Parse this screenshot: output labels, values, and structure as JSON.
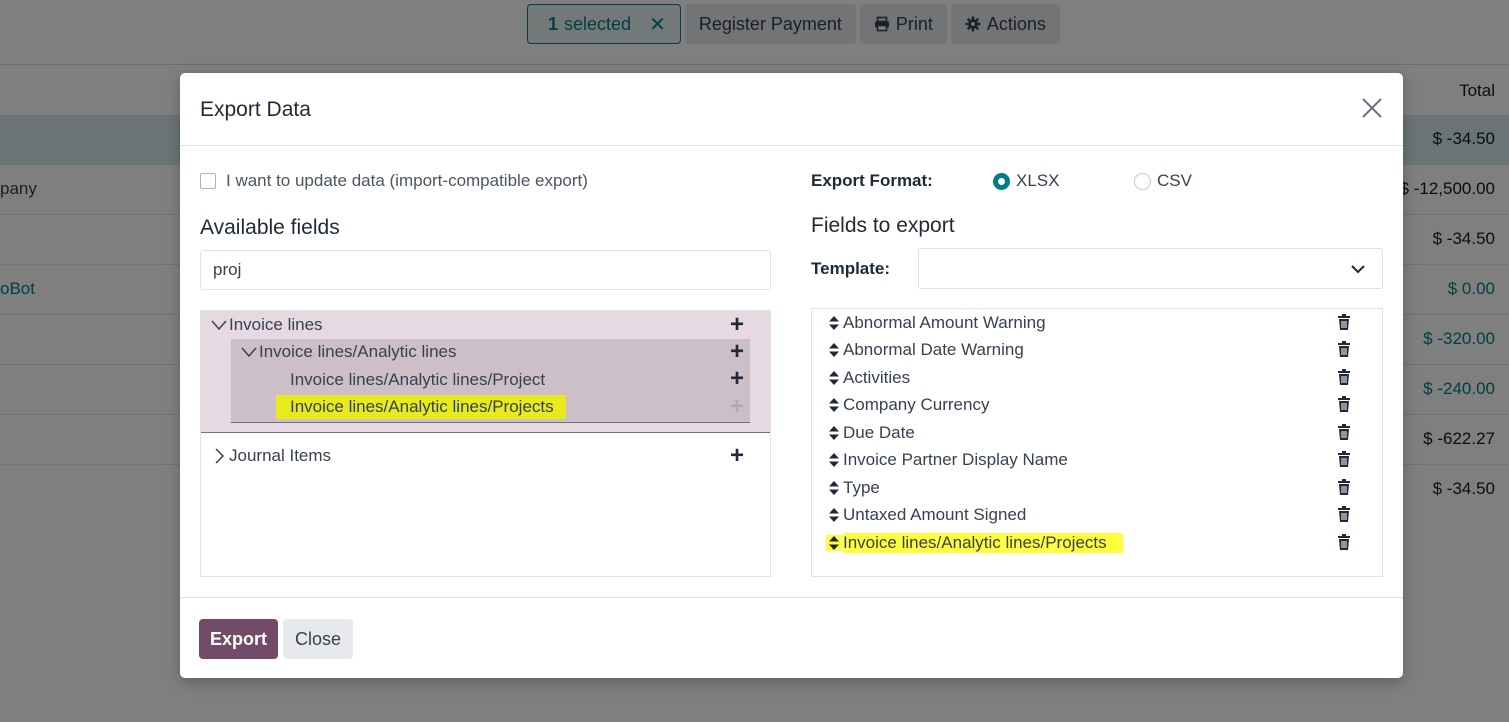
{
  "toolbar": {
    "selected_count": "1",
    "selected_label": "selected",
    "register_payment": "Register Payment",
    "print": "Print",
    "actions": "Actions"
  },
  "background_list": {
    "total_header": "Total",
    "rows": [
      {
        "left": "",
        "amount": "$ -34.50",
        "selected": true
      },
      {
        "left": "pany",
        "amount": "$ -12,500.00"
      },
      {
        "left": "",
        "amount": "$ -34.50"
      },
      {
        "left": "oBot",
        "amount": "$ 0.00"
      },
      {
        "left": "",
        "amount": "$ -320.00"
      },
      {
        "left": "",
        "amount": "$ -240.00"
      },
      {
        "left": "",
        "amount": "$ -622.27"
      },
      {
        "left": "",
        "amount": "$ -34.50"
      }
    ]
  },
  "dialog": {
    "title": "Export Data",
    "import_compatible_label": "I want to update data (import-compatible export)",
    "available_fields_heading": "Available fields",
    "search_value": "proj",
    "tree": {
      "invoice_lines": "Invoice lines",
      "analytic_lines": "Invoice lines/Analytic lines",
      "project": "Invoice lines/Analytic lines/Project",
      "projects": "Invoice lines/Analytic lines/Projects",
      "journal_items": "Journal Items"
    },
    "export_format_label": "Export Format:",
    "format_options": [
      "XLSX",
      "CSV"
    ],
    "selected_format": "XLSX",
    "fields_to_export_heading": "Fields to export",
    "template_label": "Template:",
    "template_value": "",
    "export_fields": [
      "Abnormal Amount Warning",
      "Abnormal Date Warning",
      "Activities",
      "Company Currency",
      "Due Date",
      "Invoice Partner Display Name",
      "Type",
      "Untaxed Amount Signed",
      "Invoice lines/Analytic lines/Projects"
    ],
    "export_button": "Export",
    "close_button": "Close"
  },
  "colors": {
    "primary": "#714b67",
    "accent": "#017e84",
    "highlight": "#e8ea1b"
  }
}
